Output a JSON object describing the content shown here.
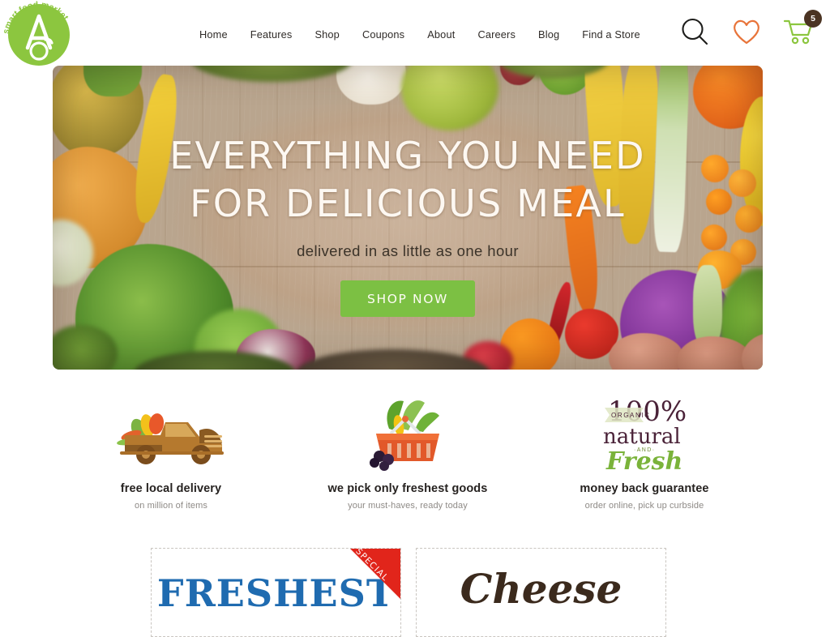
{
  "brand": {
    "logo_line1": "smart food market",
    "logo_letter": "A",
    "logo_color": "#8cc63f"
  },
  "nav": {
    "items": [
      {
        "label": "Home"
      },
      {
        "label": "Features"
      },
      {
        "label": "Shop"
      },
      {
        "label": "Coupons"
      },
      {
        "label": "About"
      },
      {
        "label": "Careers"
      },
      {
        "label": "Blog"
      },
      {
        "label": "Find a Store"
      }
    ]
  },
  "header_icons": {
    "search": "search-icon",
    "wishlist": "heart-icon",
    "cart": "cart-icon",
    "cart_count": "5",
    "search_color": "#1d1d1b",
    "heart_color": "#e8743a",
    "cart_color": "#8cc63f",
    "badge_color": "#4b3423"
  },
  "hero": {
    "title_line1": "EVERYTHING YOU NEED",
    "title_line2": "FOR DELICIOUS MEAL",
    "subtitle": "delivered in as little as one hour",
    "cta_label": "SHOP NOW",
    "cta_color": "#7cc043"
  },
  "features": [
    {
      "icon": "delivery-truck-icon",
      "title": "free local delivery",
      "subtitle": "on million of items"
    },
    {
      "icon": "shopping-basket-icon",
      "title": "we pick only freshest goods",
      "subtitle": "your must-haves, ready today"
    },
    {
      "icon": "organic-natural-fresh-badge-icon",
      "title": "money back guarantee",
      "subtitle": "order online, pick up curbside"
    }
  ],
  "badge_art": {
    "percent": "100%",
    "ribbon_word": "ORGANIC",
    "word_natural": "natural",
    "word_and": "AND",
    "word_fresh": "Fresh"
  },
  "cards": [
    {
      "title": "FRESHEST",
      "ribbon": "SPECIAL",
      "ribbon_color": "#e1251b",
      "title_color": "#1f6bb0"
    },
    {
      "title": "Cheese",
      "title_color": "#3b2a1d"
    }
  ]
}
